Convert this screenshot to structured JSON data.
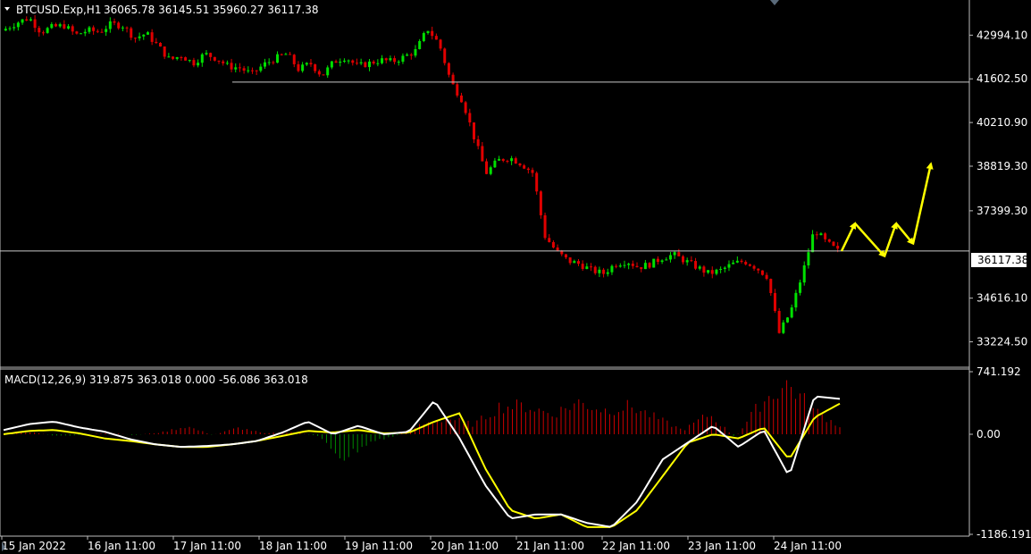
{
  "header": {
    "symbol": "BTCUSD.Exp,H1",
    "ohlc": "36065.78 36145.51 35960.27 36117.38"
  },
  "macd_header": {
    "text": "MACD(12,26,9) 319.875 363.018 0.000 -56.086 363.018"
  },
  "current_price_label": "36117.38",
  "colors": {
    "background": "#000000",
    "bull": "#00e000",
    "bear": "#e00000",
    "macd_line": "#ffffff",
    "signal_line": "#ffff00",
    "histogram_pos": "#cc0000",
    "histogram_neg": "#008800",
    "arrows": "#ffff00",
    "hlines": "#c8c8c8"
  },
  "chart_data": [
    {
      "type": "candlestick",
      "title": "BTCUSD.Exp,H1",
      "ylim": [
        32500,
        44000
      ],
      "y_ticks": [
        "42994.10",
        "41602.50",
        "40210.90",
        "38819.30",
        "37399.30",
        "34616.10",
        "33224.50"
      ],
      "x_ticks": [
        "15 Jan 2022",
        "16 Jan 11:00",
        "17 Jan 11:00",
        "18 Jan 11:00",
        "19 Jan 11:00",
        "20 Jan 11:00",
        "21 Jan 11:00",
        "22 Jan 11:00",
        "23 Jan 11:00",
        "24 Jan 11:00"
      ],
      "close_path": [
        43200,
        43400,
        43550,
        43100,
        43250,
        43300,
        43000,
        43150,
        43100,
        43350,
        43300,
        42900,
        43050,
        42650,
        42200,
        42350,
        42100,
        42400,
        42250,
        42000,
        41950,
        41750,
        42050,
        42250,
        42400,
        41900,
        42100,
        41700,
        42150,
        42300,
        42000,
        42100,
        42200,
        42150,
        42300,
        42500,
        43200,
        42700,
        41500,
        40900,
        39700,
        38600,
        39000,
        39100,
        38900,
        38600,
        36600,
        36100,
        35800,
        35700,
        35500,
        35400,
        35700,
        35800,
        35600,
        35700,
        35900,
        36000,
        35800,
        35600,
        35400,
        35500,
        35700,
        35800,
        35600,
        35300,
        33500,
        34200,
        35400,
        36800,
        36400,
        36117
      ],
      "hlines": [
        41500,
        36117
      ],
      "forecast_arrows": [
        [
          36117,
          37000
        ],
        [
          37000,
          35950
        ],
        [
          35950,
          37000
        ],
        [
          37000,
          36350
        ],
        [
          36350,
          38900
        ]
      ]
    },
    {
      "type": "macd",
      "params": "MACD(12,26,9)",
      "ylim": [
        -1186.191,
        741.192
      ],
      "y_ticks": [
        "741.192",
        "0.00",
        "-1186.191"
      ],
      "macd_path": [
        50,
        120,
        150,
        80,
        30,
        -60,
        -120,
        -150,
        -140,
        -120,
        -80,
        20,
        150,
        0,
        100,
        0,
        30,
        400,
        -50,
        -600,
        -1000,
        -950,
        -950,
        -1050,
        -1100,
        -800,
        -300,
        -100,
        100,
        -150,
        50,
        -500,
        450,
        419
      ],
      "signal_path": [
        0,
        40,
        50,
        10,
        -50,
        -80,
        -120,
        -150,
        -150,
        -120,
        -80,
        -20,
        40,
        20,
        50,
        10,
        20,
        150,
        250,
        -400,
        -900,
        -1000,
        -950,
        -1100,
        -1100,
        -900,
        -500,
        -100,
        0,
        -50,
        80,
        -300,
        200,
        363
      ],
      "histogram_path": [
        0,
        30,
        -20,
        -10,
        20,
        -10,
        20,
        100,
        -10,
        80,
        10,
        30,
        -20,
        -300,
        -100,
        -20,
        120,
        200,
        120,
        350,
        350,
        250,
        400,
        300,
        350,
        200,
        50,
        250,
        -40,
        400,
        630,
        300,
        100
      ]
    }
  ]
}
